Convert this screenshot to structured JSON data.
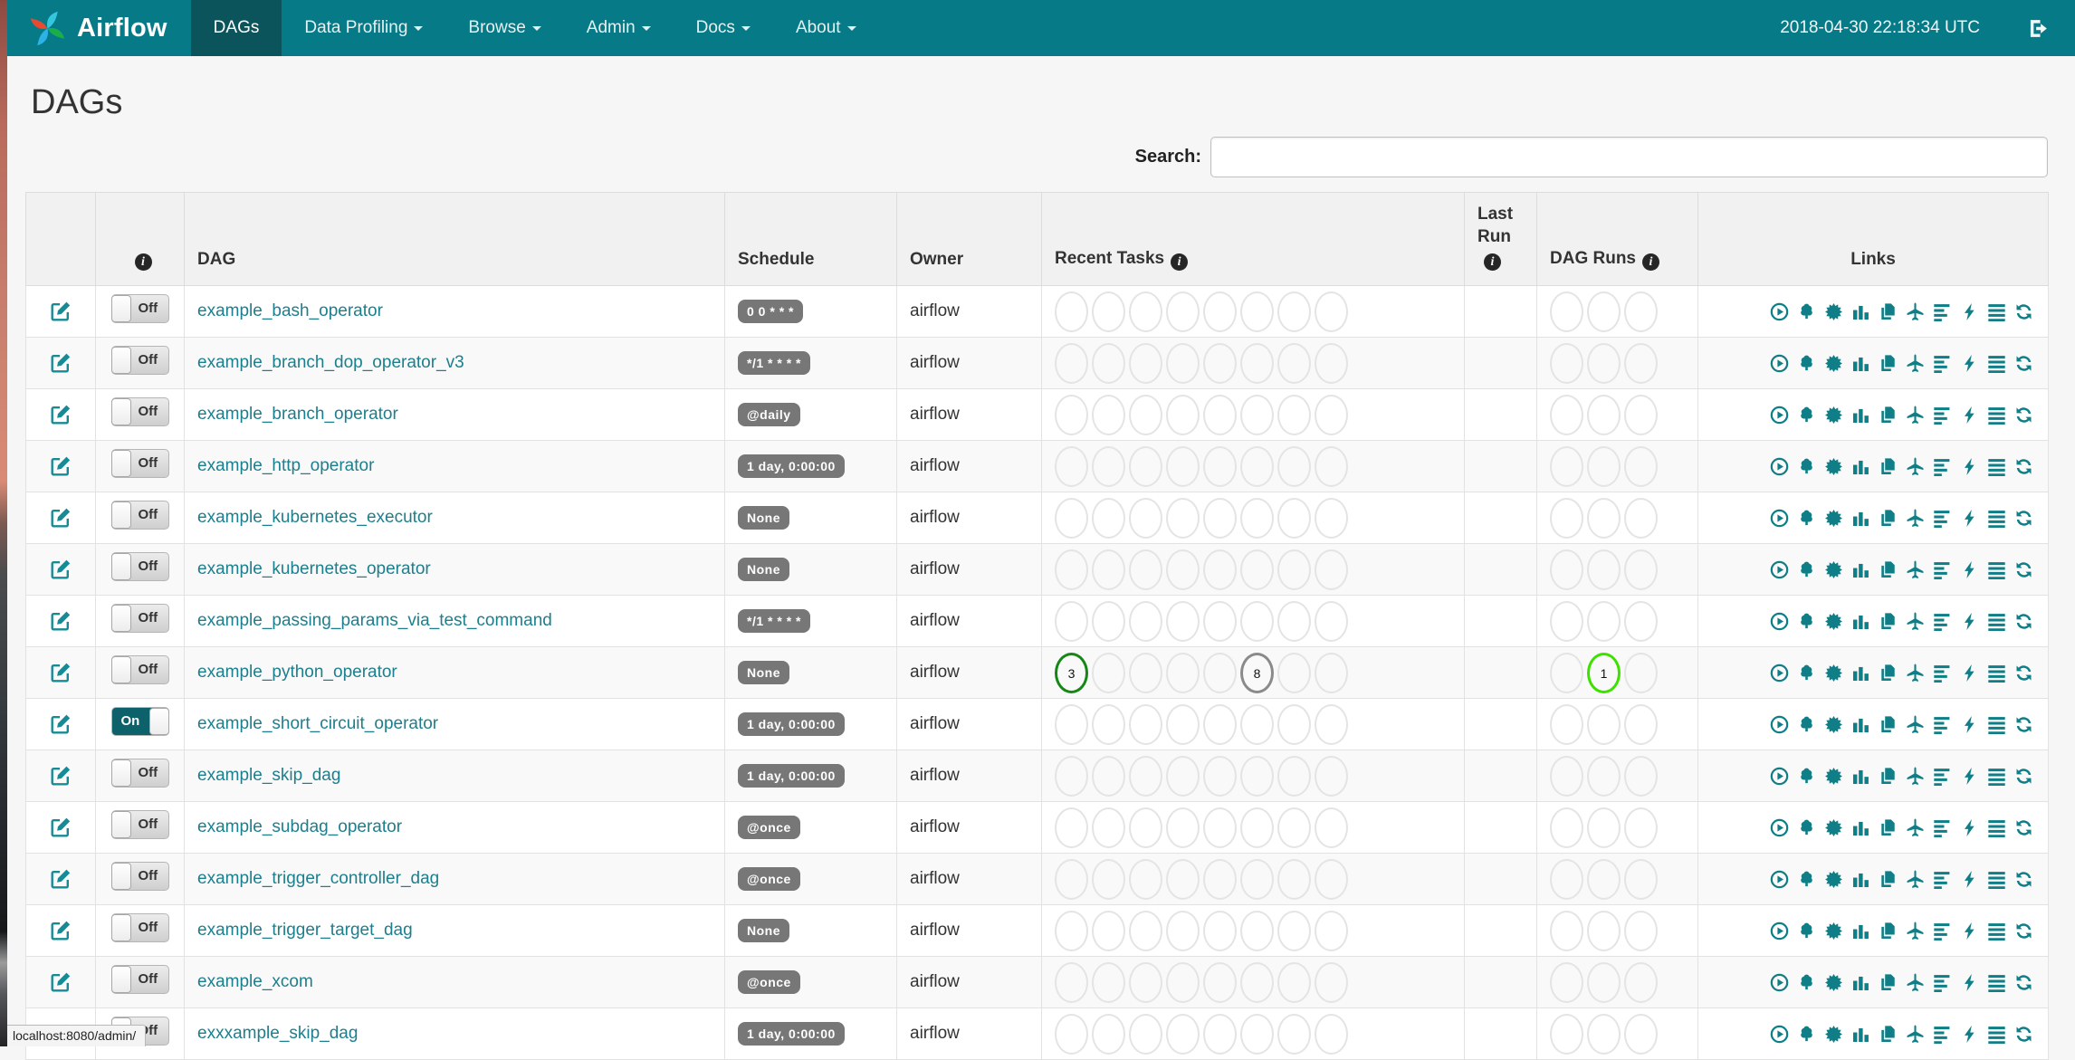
{
  "navbar": {
    "brand": "Airflow",
    "items": [
      {
        "label": "DAGs",
        "active": true,
        "caret": false
      },
      {
        "label": "Data Profiling",
        "active": false,
        "caret": true
      },
      {
        "label": "Browse",
        "active": false,
        "caret": true
      },
      {
        "label": "Admin",
        "active": false,
        "caret": true
      },
      {
        "label": "Docs",
        "active": false,
        "caret": true
      },
      {
        "label": "About",
        "active": false,
        "caret": true
      }
    ],
    "clock": "2018-04-30 22:18:34 UTC",
    "logout_icon": "logout-icon"
  },
  "page": {
    "title": "DAGs"
  },
  "search": {
    "label": "Search:",
    "value": ""
  },
  "colors": {
    "navbar_teal": "#077a87",
    "navbar_active": "#0c545c",
    "link_teal": "#1c7f8d",
    "icon_teal": "#0f7e87",
    "badge_gray": "#777777",
    "task_success_green": "#168716",
    "task_queued_gray": "#8a8a8a",
    "dagrun_running_lime": "#3fe000"
  },
  "table": {
    "columns": [
      {
        "key": "edit",
        "label": "",
        "info": false
      },
      {
        "key": "toggle",
        "label": "",
        "info": true
      },
      {
        "key": "dag",
        "label": "DAG",
        "info": false
      },
      {
        "key": "schedule",
        "label": "Schedule",
        "info": false
      },
      {
        "key": "owner",
        "label": "Owner",
        "info": false
      },
      {
        "key": "recent_tasks",
        "label": "Recent Tasks",
        "info": true
      },
      {
        "key": "last_run",
        "label": "Last Run",
        "info": true
      },
      {
        "key": "dag_runs",
        "label": "DAG Runs",
        "info": true
      },
      {
        "key": "links",
        "label": "Links",
        "info": false
      }
    ],
    "toggle_labels": {
      "on": "On",
      "off": "Off"
    },
    "recent_task_slots": 8,
    "dag_run_slots": 3,
    "links_icons": [
      "trigger-dag-icon",
      "tree-view-icon",
      "graph-view-icon",
      "task-duration-icon",
      "task-tries-icon",
      "landing-times-icon",
      "gantt-icon",
      "code-icon",
      "logs-icon",
      "refresh-icon"
    ],
    "rows": [
      {
        "name": "example_bash_operator",
        "enabled": false,
        "schedule": "0 0 * * *",
        "owner": "airflow",
        "recent_tasks": [],
        "last_run": "",
        "dag_runs": []
      },
      {
        "name": "example_branch_dop_operator_v3",
        "enabled": false,
        "schedule": "*/1 * * * *",
        "owner": "airflow",
        "recent_tasks": [],
        "last_run": "",
        "dag_runs": []
      },
      {
        "name": "example_branch_operator",
        "enabled": false,
        "schedule": "@daily",
        "owner": "airflow",
        "recent_tasks": [],
        "last_run": "",
        "dag_runs": []
      },
      {
        "name": "example_http_operator",
        "enabled": false,
        "schedule": "1 day, 0:00:00",
        "owner": "airflow",
        "recent_tasks": [],
        "last_run": "",
        "dag_runs": []
      },
      {
        "name": "example_kubernetes_executor",
        "enabled": false,
        "schedule": "None",
        "owner": "airflow",
        "recent_tasks": [],
        "last_run": "",
        "dag_runs": []
      },
      {
        "name": "example_kubernetes_operator",
        "enabled": false,
        "schedule": "None",
        "owner": "airflow",
        "recent_tasks": [],
        "last_run": "",
        "dag_runs": []
      },
      {
        "name": "example_passing_params_via_test_command",
        "enabled": false,
        "schedule": "*/1 * * * *",
        "owner": "airflow",
        "recent_tasks": [],
        "last_run": "",
        "dag_runs": []
      },
      {
        "name": "example_python_operator",
        "enabled": false,
        "schedule": "None",
        "owner": "airflow",
        "recent_tasks": [
          {
            "slot": 1,
            "count": "3",
            "color": "#168716"
          },
          {
            "slot": 6,
            "count": "8",
            "color": "#8a8a8a"
          }
        ],
        "last_run": "",
        "dag_runs": [
          {
            "slot": 2,
            "count": "1",
            "color": "#3fe000"
          }
        ]
      },
      {
        "name": "example_short_circuit_operator",
        "enabled": true,
        "schedule": "1 day, 0:00:00",
        "owner": "airflow",
        "recent_tasks": [],
        "last_run": "",
        "dag_runs": []
      },
      {
        "name": "example_skip_dag",
        "enabled": false,
        "schedule": "1 day, 0:00:00",
        "owner": "airflow",
        "recent_tasks": [],
        "last_run": "",
        "dag_runs": []
      },
      {
        "name": "example_subdag_operator",
        "enabled": false,
        "schedule": "@once",
        "owner": "airflow",
        "recent_tasks": [],
        "last_run": "",
        "dag_runs": []
      },
      {
        "name": "example_trigger_controller_dag",
        "enabled": false,
        "schedule": "@once",
        "owner": "airflow",
        "recent_tasks": [],
        "last_run": "",
        "dag_runs": []
      },
      {
        "name": "example_trigger_target_dag",
        "enabled": false,
        "schedule": "None",
        "owner": "airflow",
        "recent_tasks": [],
        "last_run": "",
        "dag_runs": []
      },
      {
        "name": "example_xcom",
        "enabled": false,
        "schedule": "@once",
        "owner": "airflow",
        "recent_tasks": [],
        "last_run": "",
        "dag_runs": []
      },
      {
        "name": "exxxample_skip_dag",
        "enabled": false,
        "schedule": "1 day, 0:00:00",
        "owner": "airflow",
        "recent_tasks": [],
        "last_run": "",
        "dag_runs": []
      }
    ]
  },
  "status_bar": {
    "text": "localhost:8080/admin/"
  }
}
